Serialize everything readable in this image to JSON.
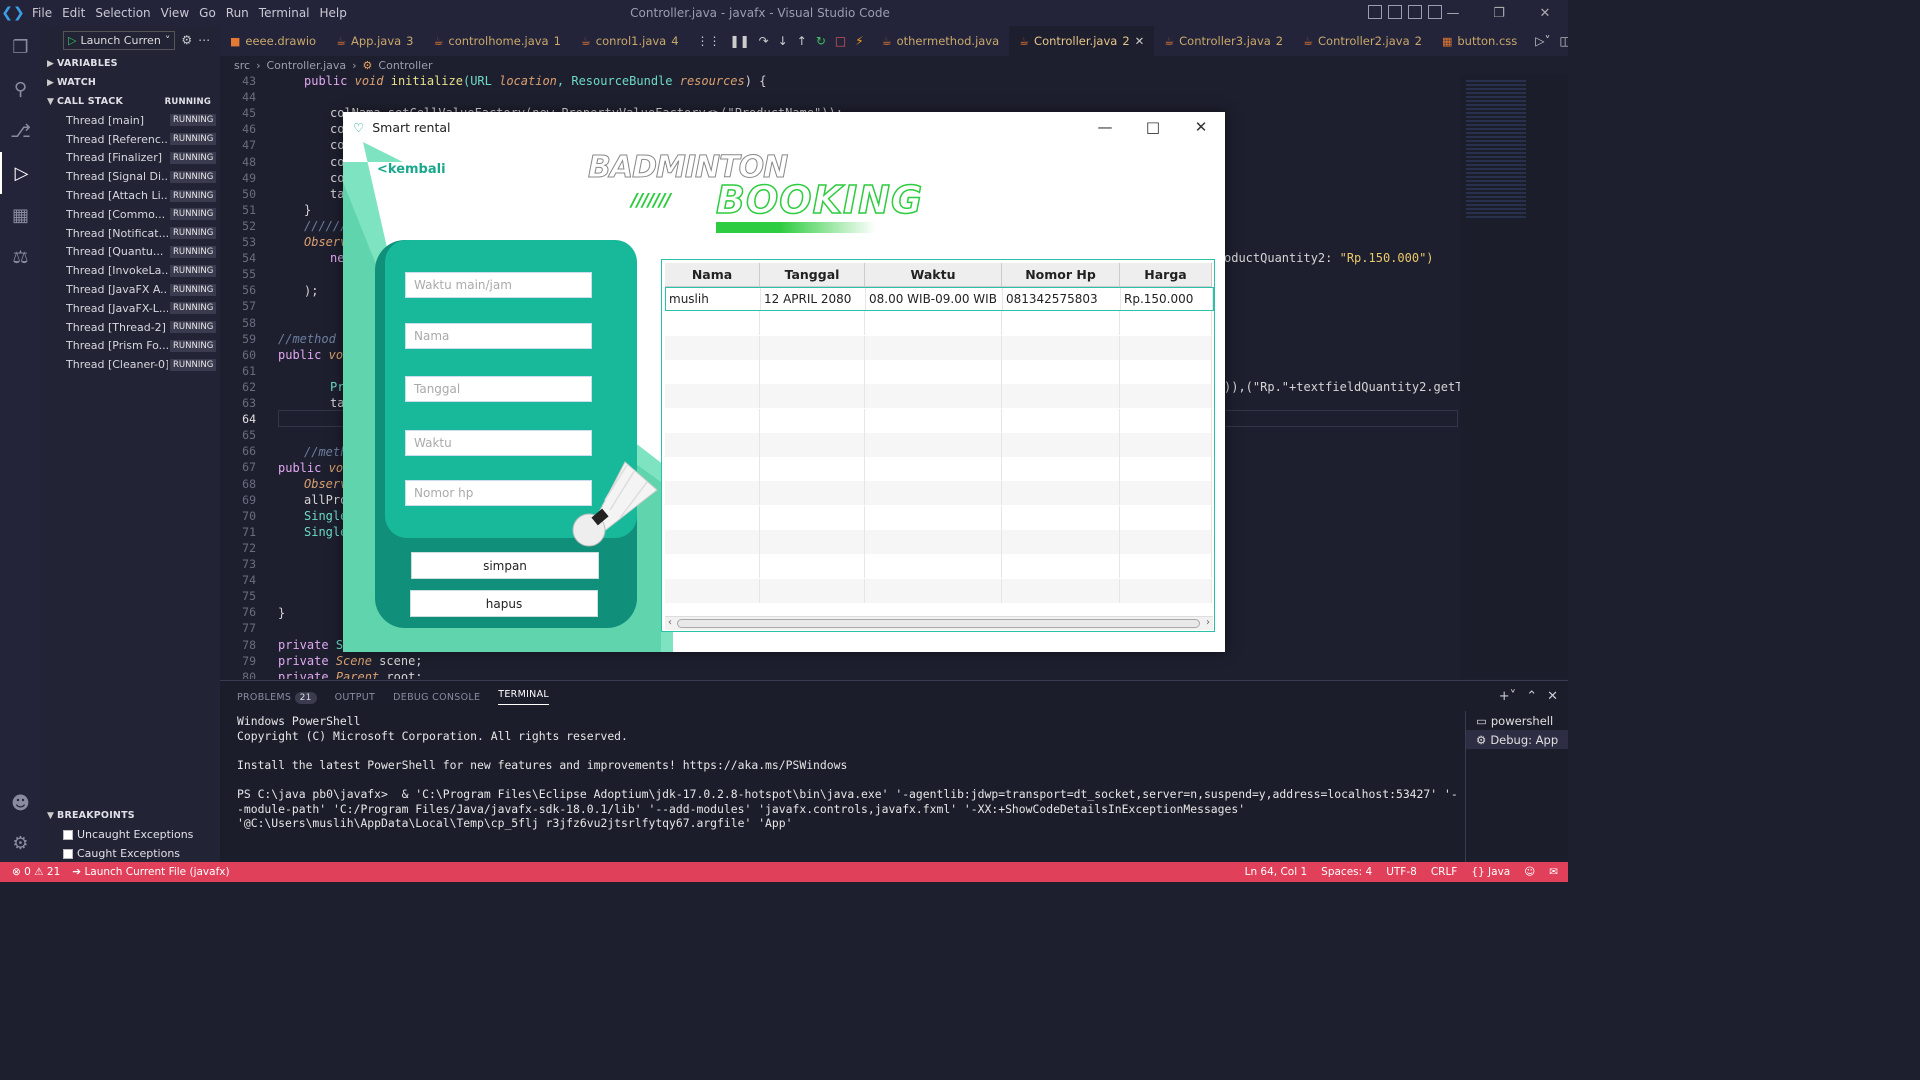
{
  "menu": [
    "File",
    "Edit",
    "Selection",
    "View",
    "Go",
    "Run",
    "Terminal",
    "Help"
  ],
  "window_title": "Controller.java - javafx - Visual Studio Code",
  "launch_config": "Launch Curren",
  "sections": {
    "variables": "VARIABLES",
    "watch": "WATCH",
    "call_stack": "CALL STACK",
    "call_stack_state": "RUNNING",
    "breakpoints": "BREAKPOINTS"
  },
  "threads": [
    {
      "name": "Thread [main]",
      "state": "RUNNING"
    },
    {
      "name": "Thread [Referenc...",
      "state": "RUNNING"
    },
    {
      "name": "Thread [Finalizer]",
      "state": "RUNNING"
    },
    {
      "name": "Thread [Signal Di...",
      "state": "RUNNING"
    },
    {
      "name": "Thread [Attach Li...",
      "state": "RUNNING"
    },
    {
      "name": "Thread [Commo...",
      "state": "RUNNING"
    },
    {
      "name": "Thread [Notificat...",
      "state": "RUNNING"
    },
    {
      "name": "Thread [Quantu...",
      "state": "RUNNING"
    },
    {
      "name": "Thread [InvokeLa...",
      "state": "RUNNING"
    },
    {
      "name": "Thread [JavaFX A...",
      "state": "RUNNING"
    },
    {
      "name": "Thread [JavaFX-L...",
      "state": "RUNNING"
    },
    {
      "name": "Thread [Thread-2]",
      "state": "RUNNING"
    },
    {
      "name": "Thread [Prism Fo...",
      "state": "RUNNING"
    },
    {
      "name": "Thread [Cleaner-0]",
      "state": "RUNNING"
    }
  ],
  "breakpoints": [
    "Uncaught Exceptions",
    "Caught Exceptions"
  ],
  "tabs": [
    {
      "label": "eeee.drawio",
      "badge": ""
    },
    {
      "label": "App.java",
      "badge": "3"
    },
    {
      "label": "controlhome.java",
      "badge": "1"
    },
    {
      "label": "conrol1.java",
      "badge": "4"
    },
    {
      "label": "othermethod.java",
      "badge": ""
    },
    {
      "label": "Controller.java",
      "badge": "2"
    },
    {
      "label": "Controller3.java",
      "badge": "2"
    },
    {
      "label": "Controller2.java",
      "badge": "2"
    },
    {
      "label": "button.css",
      "badge": ""
    }
  ],
  "breadcrumb": [
    "src",
    "Controller.java",
    "Controller"
  ],
  "line_numbers": [
    "43",
    "44",
    "45",
    "46",
    "47",
    "48",
    "49",
    "50",
    "51",
    "52",
    "53",
    "54",
    "55",
    "56",
    "57",
    "58",
    "59",
    "60",
    "61",
    "62",
    "63",
    "64",
    "65",
    "66",
    "67",
    "68",
    "69",
    "70",
    "71",
    "72",
    "73",
    "74",
    "75",
    "76",
    "77",
    "78",
    "79",
    "80"
  ],
  "code_snippets": {
    "l43a": "public",
    "l43b": "void",
    "l43c": "initialize",
    "l43d": "(URL ",
    "l43e": "location",
    "l43f": ", ResourceBundle ",
    "l43g": "resources",
    "l43h": ") {",
    "l45": "colNama.setCellValueFactory(new PropertyValueFactory<>(\"ProductName\"));",
    "l46": "co",
    "l47": "co",
    "l48": "co",
    "l49": "co",
    "l50": "ta",
    "l51": "}",
    "l52": "//////",
    "l53": "Observ",
    "l54a": "ne",
    "l54b": "oductQuantity2: ",
    "l54c": "\"Rp.150.000\")",
    "l56": ");",
    "l59": "//method b",
    "l60a": "public",
    "l60b": "voi",
    "l62a": "Pr",
    "l62b": ")),(\"Rp.\"+textfieldQuantity2.getTex",
    "l63": "ta",
    "l66": "//meth",
    "l67a": "public",
    "l67b": "voi",
    "l68": "Observ",
    "l69": "allPro",
    "l70": "Single",
    "l71": "Single",
    "l76": "}",
    "l78a": "private",
    "l78b": "St",
    "l79a": "private",
    "l79b": "Scene",
    "l79c": "scene;",
    "l80a": "private",
    "l80b": "Parent",
    "l80c": "root;"
  },
  "panel": {
    "problems": "PROBLEMS",
    "problems_count": "21",
    "output": "OUTPUT",
    "debug_console": "DEBUG CONSOLE",
    "terminal": "TERMINAL"
  },
  "terminal_lines": [
    "Windows PowerShell",
    "Copyright (C) Microsoft Corporation. All rights reserved.",
    "",
    "Install the latest PowerShell for new features and improvements! https://aka.ms/PSWindows",
    "",
    "PS C:\\java pb0\\javafx>  & 'C:\\Program Files\\Eclipse Adoptium\\jdk-17.0.2.8-hotspot\\bin\\java.exe' '-agentlib:jdwp=transport=dt_socket,server=n,suspend=y,address=localhost:53427' '--module-path' 'C:/Program Files/Java/javafx-sdk-18.0.1/lib' '--add-modules' 'javafx.controls,javafx.fxml' '-XX:+ShowCodeDetailsInExceptionMessages' '@C:\\Users\\muslih\\AppData\\Local\\Temp\\cp_5flj r3jfz6vu2jtsrlfytqy67.argfile' 'App'"
  ],
  "terminal_list": [
    "powershell",
    "Debug: App"
  ],
  "status": {
    "errors": "0",
    "warnings": "21",
    "launch": "Launch Current File (javafx)",
    "position": "Ln 64, Col 1",
    "spaces": "Spaces: 4",
    "encoding": "UTF-8",
    "eol": "CRLF",
    "language": "Java"
  },
  "app": {
    "title": "Smart rental",
    "back": "<kembali",
    "logo_top": "BADMINTON",
    "logo_bottom": "BOOKING",
    "fields": [
      "Waktu main/jam",
      "Nama",
      "Tanggal",
      "Waktu",
      "Nomor hp"
    ],
    "save": "simpan",
    "delete": "hapus",
    "columns": [
      "Nama",
      "Tanggal",
      "Waktu",
      "Nomor Hp",
      "Harga"
    ],
    "rows": [
      [
        "muslih",
        "12 APRIL 2080",
        "08.00 WIB-09.00 WIB",
        "081342575803",
        "Rp.150.000"
      ]
    ]
  },
  "colors": {
    "accent": "#18b99a",
    "status_bar": "#e0405a",
    "logo_green": "#2ecc40"
  }
}
